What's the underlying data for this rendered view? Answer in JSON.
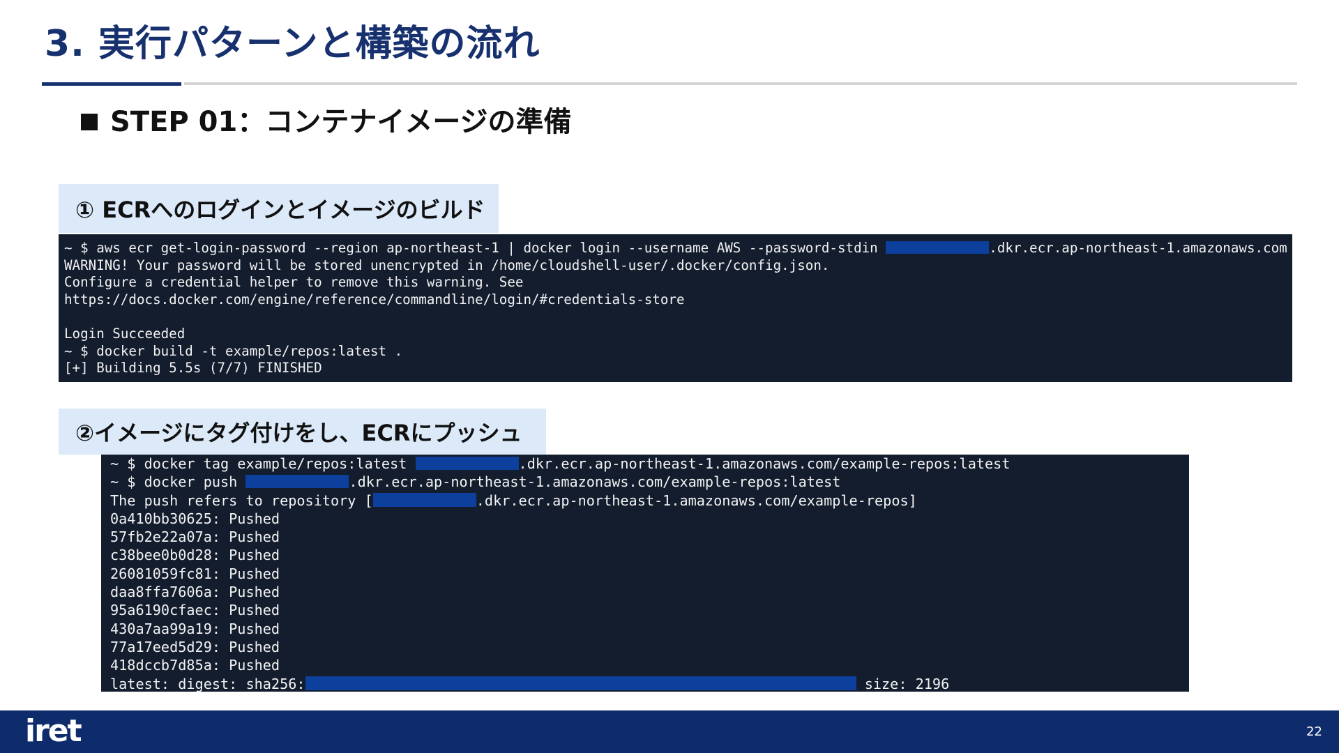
{
  "slide": {
    "title": "3.  実行パターンと構築の流れ",
    "step_heading": "STEP 01：コンテナイメージの準備",
    "page_number": "22"
  },
  "brand": {
    "logo": "iret"
  },
  "colors": {
    "primary": "#17306e",
    "label_bg": "#dbe9f8",
    "terminal_bg": "#131d2e",
    "redaction": "#0d3f9c",
    "footer": "#0e2b6b"
  },
  "section1": {
    "label": "① ECRへのログインとイメージのビルド",
    "terminal": [
      {
        "pre": "~ $ aws ecr get-login-password --region ap-northeast-1 | docker login --username AWS --password-stdin ",
        "post": ".dkr.ecr.ap-northeast-1.amazonaws.com"
      },
      {
        "pre": "WARNING! Your password will be stored unencrypted in /home/cloudshell-user/.docker/config.json."
      },
      {
        "pre": "Configure a credential helper to remove this warning. See"
      },
      {
        "pre": "https://docs.docker.com/engine/reference/commandline/login/#credentials-store"
      },
      {
        "pre": ""
      },
      {
        "pre": "Login Succeeded"
      },
      {
        "pre": "~ $ docker build -t example/repos:latest ."
      },
      {
        "pre": "[+] Building 5.5s (7/7) FINISHED"
      }
    ]
  },
  "section2": {
    "label": "②イメージにタグ付けをし、ECRにプッシュ",
    "terminal": [
      {
        "pre": "~ $ docker tag example/repos:latest ",
        "post": ".dkr.ecr.ap-northeast-1.amazonaws.com/example-repos:latest"
      },
      {
        "pre": "~ $ docker push ",
        "post": ".dkr.ecr.ap-northeast-1.amazonaws.com/example-repos:latest"
      },
      {
        "pre": "The push refers to repository [",
        "post": ".dkr.ecr.ap-northeast-1.amazonaws.com/example-repos]"
      },
      {
        "pre": "0a410bb30625: Pushed"
      },
      {
        "pre": "57fb2e22a07a: Pushed"
      },
      {
        "pre": "c38bee0b0d28: Pushed"
      },
      {
        "pre": "26081059fc81: Pushed"
      },
      {
        "pre": "daa8ffa7606a: Pushed"
      },
      {
        "pre": "95a6190cfaec: Pushed"
      },
      {
        "pre": "430a7aa99a19: Pushed"
      },
      {
        "pre": "77a17eed5d29: Pushed"
      },
      {
        "pre": "418dccb7d85a: Pushed"
      },
      {
        "pre": "latest: digest: sha256:",
        "post": " size: 2196"
      }
    ]
  }
}
